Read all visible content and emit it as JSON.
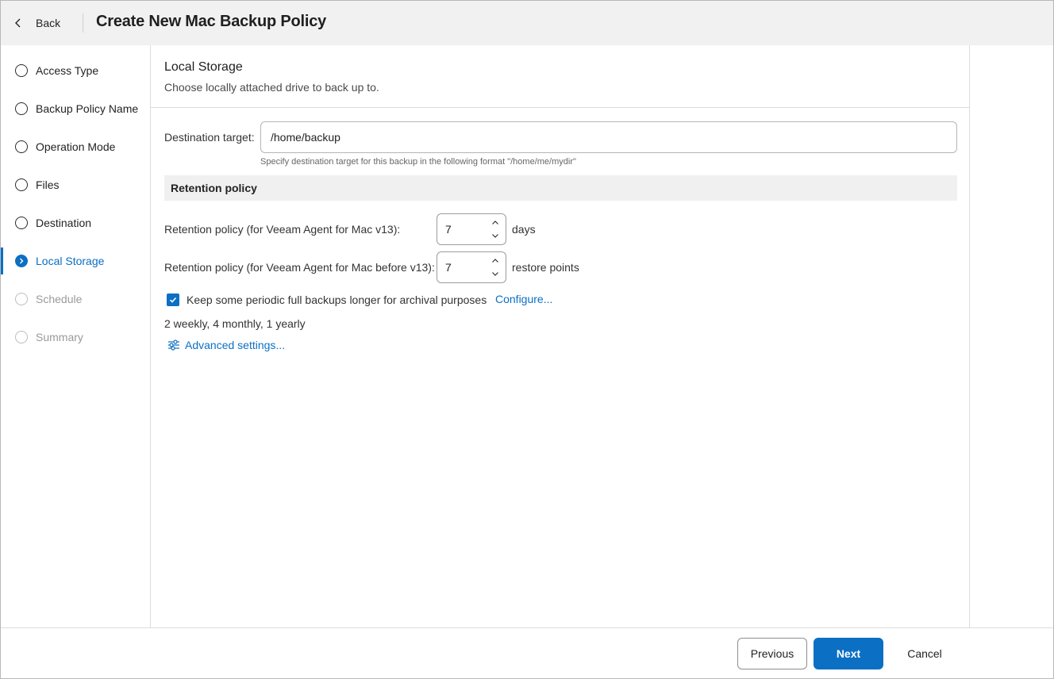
{
  "header": {
    "back_label": "Back",
    "title": "Create New Mac Backup Policy"
  },
  "sidebar": {
    "steps": [
      {
        "label": "Access Type",
        "state": "completed"
      },
      {
        "label": "Backup Policy Name",
        "state": "completed"
      },
      {
        "label": "Operation Mode",
        "state": "completed"
      },
      {
        "label": "Files",
        "state": "completed"
      },
      {
        "label": "Destination",
        "state": "completed"
      },
      {
        "label": "Local Storage",
        "state": "active"
      },
      {
        "label": "Schedule",
        "state": "disabled"
      },
      {
        "label": "Summary",
        "state": "disabled"
      }
    ]
  },
  "main": {
    "title": "Local Storage",
    "description": "Choose locally attached drive to back up to.",
    "destination": {
      "label": "Destination target:",
      "value": "/home/backup",
      "hint": "Specify destination target for this backup in the following format \"/home/me/mydir\""
    },
    "retention": {
      "header": "Retention policy",
      "v13": {
        "label": "Retention policy (for Veeam Agent for Mac v13):",
        "value": "7",
        "unit": "days"
      },
      "pre_v13": {
        "label": "Retention policy (for Veeam Agent for Mac before v13):",
        "value": "7",
        "unit": "restore points"
      }
    },
    "archival": {
      "checked": true,
      "label": "Keep some periodic full backups longer for archival purposes",
      "configure_label": "Configure...",
      "summary": "2 weekly, 4 monthly, 1 yearly"
    },
    "advanced_label": "Advanced settings..."
  },
  "footer": {
    "previous_label": "Previous",
    "next_label": "Next",
    "cancel_label": "Cancel"
  },
  "colors": {
    "accent": "#0b6fc4",
    "header_bg": "#f1f1f1",
    "disabled_text": "#9a9a9a"
  },
  "icons": {
    "back": "chevron-left-icon",
    "active_step": "chevron-right-icon",
    "stepper_up": "chevron-up-icon",
    "stepper_down": "chevron-down-icon",
    "checkbox": "checkmark-icon",
    "advanced": "sliders-icon"
  }
}
